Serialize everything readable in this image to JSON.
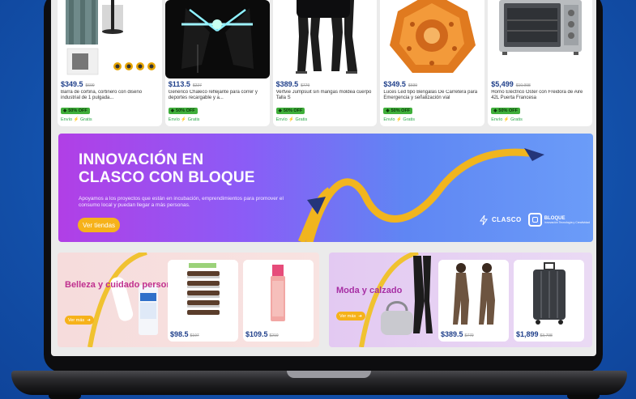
{
  "products": [
    {
      "price": "$349.5",
      "old_price": "$699",
      "title": "Barra de cortina, cortinero con diseño industrial de 1 pulgada...",
      "discount": "50% OFF",
      "shipping": "Envío ⚡ Gratis"
    },
    {
      "price": "$113.5",
      "old_price": "$227",
      "title": "Genérico Chaleco reflejante para correr y deportes recargable y a...",
      "discount": "50% OFF",
      "shipping": "Envío ⚡ Gratis"
    },
    {
      "price": "$389.5",
      "old_price": "$779",
      "title": "Vertvie Jumpsuit sin mangas moldea cuerpo Talla S",
      "discount": "50% OFF",
      "shipping": "Envío ⚡ Gratis"
    },
    {
      "price": "$349.5",
      "old_price": "$699",
      "title": "Luces Led tipo Bengalas De Carretera para Emergencia y señalización vial",
      "discount": "50% OFF",
      "shipping": "Envío ⚡ Gratis"
    },
    {
      "price": "$5,499",
      "old_price": "$10,998",
      "title": "Horno Eléctrico Oster con Freidora de Aire 42L Puerta Francesa",
      "discount": "50% OFF",
      "shipping": "Envío ⚡ Gratis"
    }
  ],
  "banner": {
    "title_line1": "INNOVACIÓN EN",
    "title_line2": "CLASCO CON BLOQUE",
    "text": "Apoyamos a los proyectos que están en incubación, emprendimientos para promover el consumo local y puedan llegar a más personas.",
    "button": "Ver tiendas",
    "logo_clasco": "CLASCO",
    "logo_bloque": "BLOQUE",
    "logo_bloque_sub": "Innovación Tecnología y Creatividad"
  },
  "categories": [
    {
      "title": "Belleza y cuidado personal",
      "button": "Ver más",
      "products": [
        {
          "price": "$98.5",
          "old_price": "$197"
        },
        {
          "price": "$109.5",
          "old_price": "$219"
        }
      ]
    },
    {
      "title": "Moda y calzado",
      "button": "Ver más",
      "products": [
        {
          "price": "$389.5",
          "old_price": "$779"
        },
        {
          "price": "$1,899",
          "old_price": "$3,798"
        }
      ]
    }
  ],
  "colors": {
    "background": "#1556b7",
    "price": "#1f3f8a",
    "discount": "#3fae3a",
    "accent_button": "#f6b21a",
    "beauty_title": "#c0308f"
  }
}
